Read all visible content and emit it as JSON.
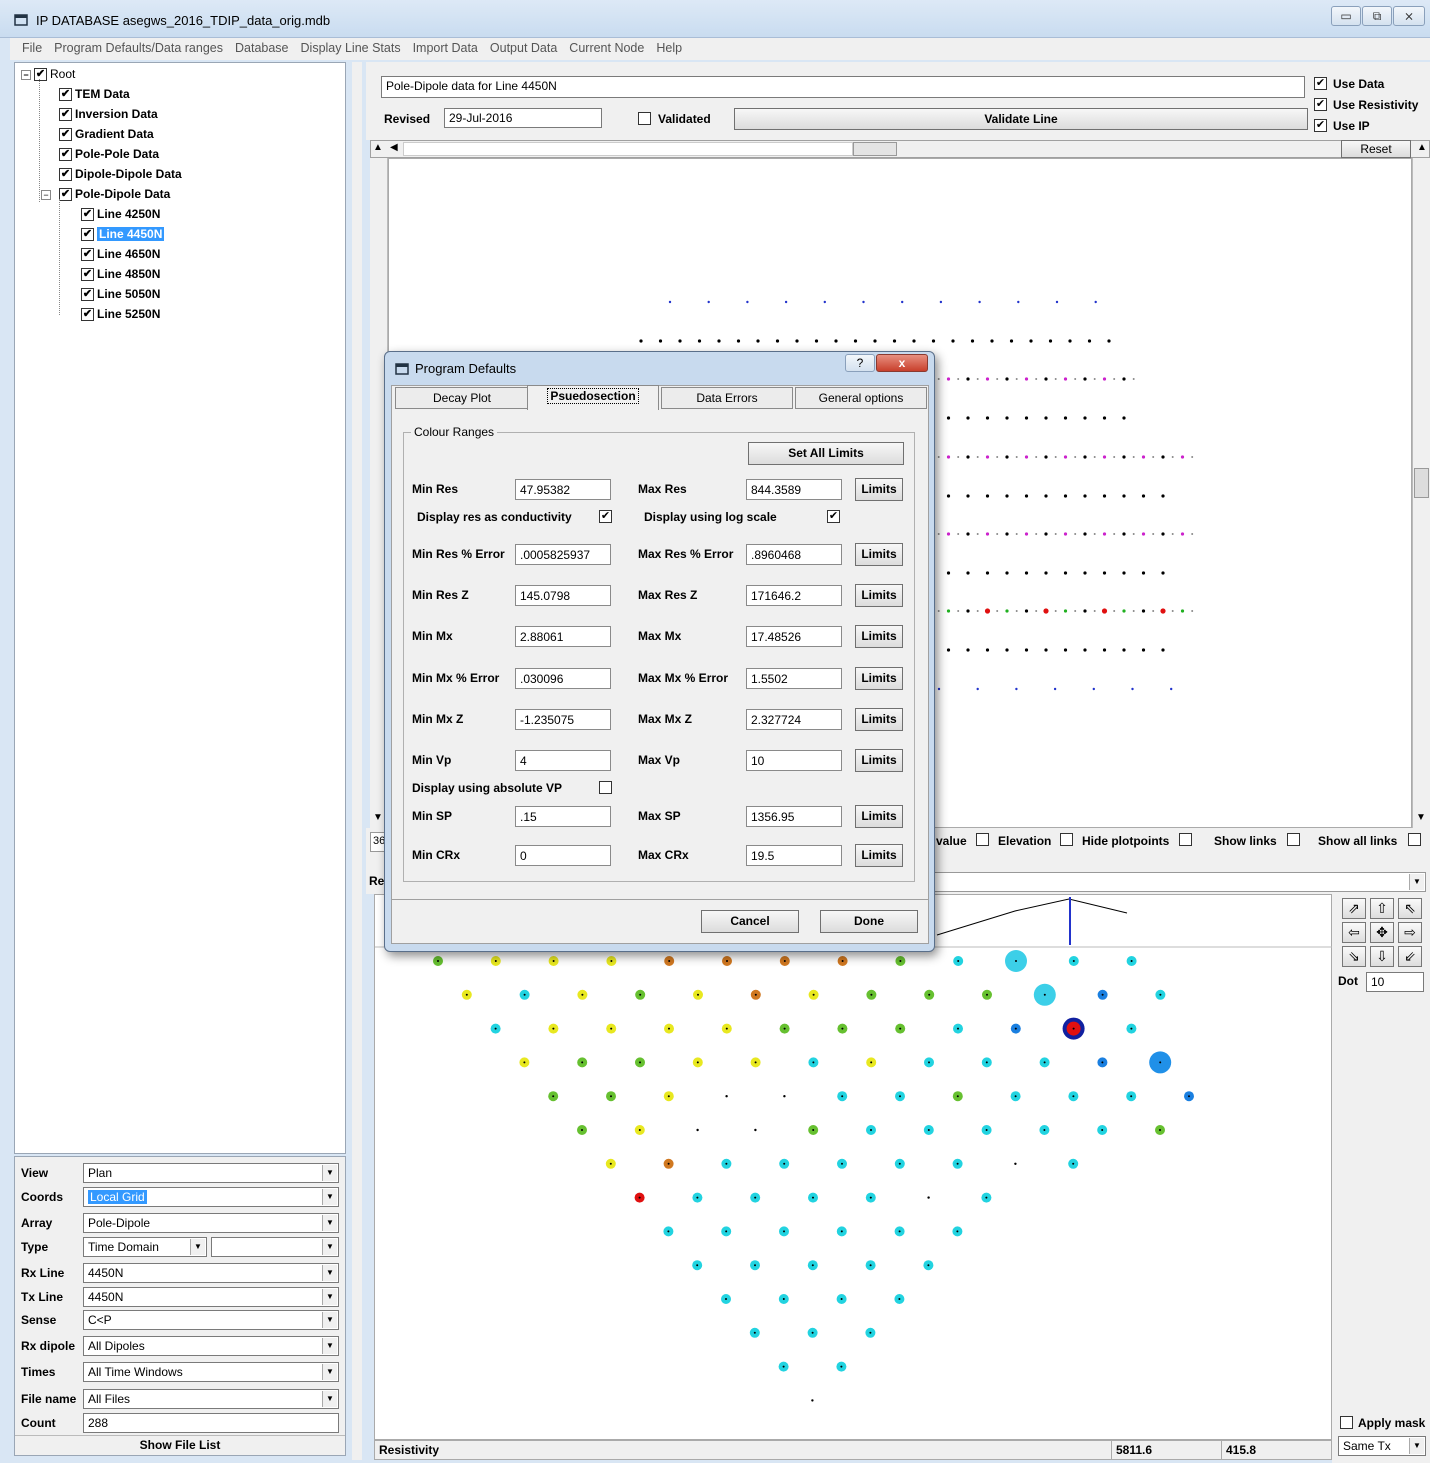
{
  "window": {
    "title": "IP DATABASE asegws_2016_TDIP_data_orig.mdb",
    "btn_min": "▭",
    "btn_max": "⧉",
    "btn_close": "⨯"
  },
  "menu": [
    "File",
    "Program Defaults/Data ranges",
    "Database",
    "Display Line Stats",
    "Import Data",
    "Output Data",
    "Current Node",
    "Help"
  ],
  "tree": {
    "root": "Root",
    "children": [
      "TEM Data",
      "Inversion Data",
      "Gradient Data",
      "Pole-Pole Data",
      "Dipole-Dipole Data",
      "Pole-Dipole Data"
    ],
    "lines": [
      "Line 4250N",
      "Line 4450N",
      "Line 4650N",
      "Line 4850N",
      "Line 5050N",
      "Line 5250N"
    ],
    "selected": "Line 4450N"
  },
  "props": {
    "view": {
      "label": "View",
      "value": "Plan"
    },
    "coords": {
      "label": "Coords",
      "value": "Local Grid"
    },
    "array": {
      "label": "Array",
      "value": "Pole-Dipole"
    },
    "type": {
      "label": "Type",
      "value": "Time Domain",
      "value2": ""
    },
    "rxline": {
      "label": "Rx Line",
      "value": "4450N"
    },
    "txline": {
      "label": "Tx Line",
      "value": "4450N"
    },
    "sense": {
      "label": "Sense",
      "value": "C<P"
    },
    "rxdipole": {
      "label": "Rx dipole",
      "value": "All Dipoles"
    },
    "times": {
      "label": "Times",
      "value": "All Time Windows"
    },
    "filename": {
      "label": "File name",
      "value": "All Files"
    },
    "count": {
      "label": "Count",
      "value": "288"
    },
    "show_file_list": "Show File List"
  },
  "header": {
    "title_value": "Pole-Dipole data for Line 4450N",
    "revised_label": "Revised",
    "revised_value": "29-Jul-2016",
    "validated_label": "Validated",
    "validate_button": "Validate Line",
    "use_data": "Use Data",
    "use_resistivity": "Use Resistivity",
    "use_ip": "Use IP",
    "reset_button": "Reset"
  },
  "mid_options": {
    "value": "value",
    "elevation": "Elevation",
    "hide_plotpoints": "Hide plotpoints",
    "show_links": "Show links",
    "show_all_links": "Show all links",
    "left_stub": "36",
    "left_stub2": "Re"
  },
  "right_controls": {
    "dot_label": "Dot",
    "dot_value": "10",
    "apply_mask": "Apply mask",
    "same_tx": "Same Tx"
  },
  "status": {
    "label": "Resistivity",
    "x": "5811.6",
    "y": "415.8"
  },
  "dialog": {
    "title": "Program Defaults",
    "help_btn": "?",
    "close_btn": "x",
    "tabs": [
      "Decay Plot",
      "Psuedosection",
      "Data Errors",
      "General options"
    ],
    "active_tab": "Psuedosection",
    "group": "Colour Ranges",
    "set_all_limits": "Set All Limits",
    "min_res_label": "Min Res",
    "min_res": "47.95382",
    "max_res_label": "Max Res",
    "max_res": "844.3589",
    "display_cond": "Display res as conductivity",
    "display_log": "Display using log scale",
    "min_res_err_label": "Min Res % Error",
    "min_res_err": ".0005825937",
    "max_res_err_label": "Max Res % Error",
    "max_res_err": ".8960468",
    "min_resz_label": "Min Res Z",
    "min_resz": "145.0798",
    "max_resz_label": "Max Res Z",
    "max_resz": "171646.2",
    "min_mx_label": "Min Mx",
    "min_mx": "2.88061",
    "max_mx_label": "Max Mx",
    "max_mx": "17.48526",
    "min_mx_err_label": "Min Mx % Error",
    "min_mx_err": ".030096",
    "max_mx_err_label": "Max Mx % Error",
    "max_mx_err": "1.5502",
    "min_mxz_label": "Min Mx Z",
    "min_mxz": "-1.235075",
    "max_mxz_label": "Max Mx Z",
    "max_mxz": "2.327724",
    "min_vp_label": "Min Vp",
    "min_vp": "4",
    "max_vp_label": "Max Vp",
    "max_vp": "10",
    "display_abs_vp": "Display using absolute VP",
    "min_sp_label": "Min SP",
    "min_sp": ".15",
    "max_sp_label": "Max SP",
    "max_sp": "1356.95",
    "min_crx_label": "Min CRx",
    "min_crx": "0",
    "max_crx_label": "Max CRx",
    "max_crx": "19.5",
    "limits": "Limits",
    "cancel": "Cancel",
    "done": "Done"
  },
  "colors": {
    "accent": "#3399ff",
    "cyan": "#22d3e0",
    "yellow": "#e8e820",
    "green": "#66c030",
    "orange": "#d07820",
    "red": "#e01010",
    "blue": "#1a7fe0"
  }
}
